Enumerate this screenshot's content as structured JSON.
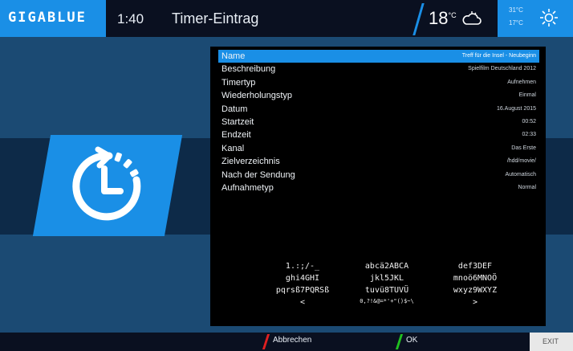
{
  "header": {
    "brand": "GIGABLUE",
    "time": "1:40",
    "title": "Timer-Eintrag",
    "temperature": "18",
    "temperature_unit": "°C",
    "weather_icon": "cloud-icon",
    "forecast": {
      "high": "31°C",
      "low": "17°C",
      "icon": "sun-icon"
    }
  },
  "accent_color": "#1a8fe6",
  "timer_icon": "timer-clock-icon",
  "entries": [
    {
      "label": "Name",
      "value": "Treff für die Insel - Neubeginn"
    },
    {
      "label": "Beschreibung",
      "value": "Spielfilm Deutschland 2012"
    },
    {
      "label": "Timertyp",
      "value": "Aufnehmen"
    },
    {
      "label": "Wiederholungstyp",
      "value": "Einmal"
    },
    {
      "label": "Datum",
      "value": "16.August 2015"
    },
    {
      "label": "Startzeit",
      "value": "00:52"
    },
    {
      "label": "Endzeit",
      "value": "02:33"
    },
    {
      "label": "Kanal",
      "value": "Das Erste"
    },
    {
      "label": "Zielverzeichnis",
      "value": "/hdd/movie/"
    },
    {
      "label": "Nach der Sendung",
      "value": "Automatisch"
    },
    {
      "label": "Aufnahmetyp",
      "value": "Normal"
    }
  ],
  "keypad": [
    [
      "1.:;/-_",
      "abcä2ABCA",
      "def3DEF"
    ],
    [
      "ghi4GHI",
      "jkl5JKL",
      "mnoö6MNOÖ"
    ],
    [
      "pqrsß7PQRSß",
      "tuvü8TUVÜ",
      "wxyz9WXYZ"
    ],
    [
      "<",
      "0,?!&@=*'+\"()$~\\",
      ">"
    ]
  ],
  "footer": {
    "cancel": "Abbrechen",
    "ok": "OK",
    "exit": "EXIT",
    "cancel_color": "#e02020",
    "ok_color": "#20c020"
  }
}
